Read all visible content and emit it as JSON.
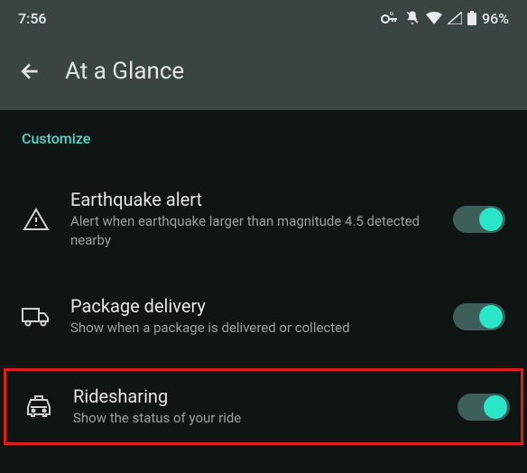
{
  "status_bar": {
    "time": "7:56",
    "battery": "96%"
  },
  "header": {
    "title": "At a Glance"
  },
  "section_label": "Customize",
  "settings": [
    {
      "title": "Earthquake alert",
      "desc": "Alert when earthquake larger than magnitude 4.5 detected nearby"
    },
    {
      "title": "Package delivery",
      "desc": "Show when a package is delivered or collected"
    },
    {
      "title": "Ridesharing",
      "desc": "Show the status of your ride"
    }
  ]
}
